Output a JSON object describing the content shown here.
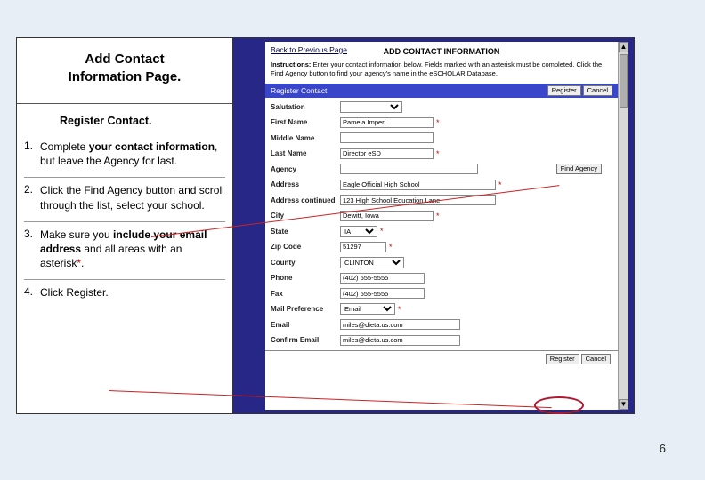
{
  "left": {
    "title_l1": "Add Contact",
    "title_l2": "Information Page.",
    "subhead": "Register Contact.",
    "steps": {
      "n1": "1.",
      "t1a": "Complete ",
      "t1b": "your contact information",
      "t1c": ", but leave the Agency for last.",
      "n2": "2.",
      "t2": "Click the Find Agency button and scroll through the list, select your school.",
      "n3": "3.",
      "t3a": "Make sure you ",
      "t3b": "include your email address",
      "t3c": " and all areas with an asterisk",
      "t3d": "*",
      "t3e": ".",
      "n4": "4.",
      "t4": "Click Register."
    }
  },
  "app": {
    "back": "Back to Previous Page",
    "header_title": "ADD CONTACT INFORMATION",
    "instr_b": "Instructions:",
    "instr": " Enter your contact information below. Fields marked with an asterisk must be completed. Click the Find Agency button to find your agency's name in the eSCHOLAR Database.",
    "section": "Register Contact",
    "register": "Register",
    "cancel": "Cancel",
    "find_agency": "Find Agency",
    "labels": {
      "salutation": "Salutation",
      "first": "First Name",
      "middle": "Middle Name",
      "last": "Last Name",
      "agency": "Agency",
      "address": "Address",
      "address2": "Address continued",
      "city": "City",
      "state": "State",
      "zip": "Zip Code",
      "county": "County",
      "phone": "Phone",
      "fax": "Fax",
      "mailpref": "Mail Preference",
      "email": "Email",
      "cemail": "Confirm Email"
    },
    "values": {
      "salutation": "",
      "first": "Pamela Imperi",
      "middle": "",
      "last": "Director eSD",
      "agency": "",
      "address": "Eagle Official High School",
      "address2": "123 High School Education Lane",
      "city": "Dewitt, Iowa",
      "state": "IA",
      "zip": "51297",
      "county": "CLINTON",
      "phone": "(402) 555-5555",
      "fax": "(402) 555-5555",
      "mailpref": "Email",
      "email": "miles@dieta.us.com",
      "cemail": "miles@dieta.us.com"
    }
  },
  "pagenum": "6"
}
